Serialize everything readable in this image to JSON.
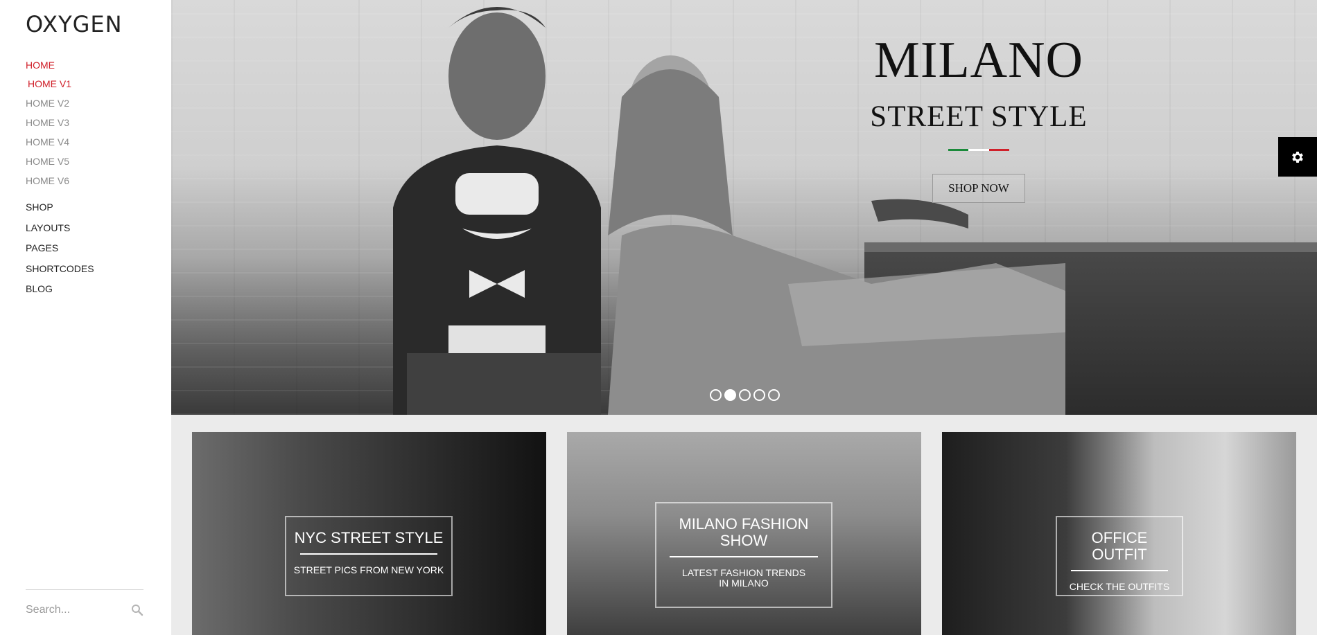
{
  "brand": {
    "logo": "OXYGEN"
  },
  "sidebar": {
    "home": {
      "label": "HOME",
      "sub": [
        {
          "label": "HOME V1"
        },
        {
          "label": "HOME V2"
        },
        {
          "label": "HOME V3"
        },
        {
          "label": "HOME V4"
        },
        {
          "label": "HOME V5"
        },
        {
          "label": "HOME V6"
        }
      ]
    },
    "items": [
      {
        "label": "SHOP"
      },
      {
        "label": "LAYOUTS"
      },
      {
        "label": "PAGES"
      },
      {
        "label": "SHORTCODES"
      },
      {
        "label": "BLOG"
      }
    ],
    "search": {
      "placeholder": "Search..."
    }
  },
  "hero": {
    "title": "MILANO",
    "subtitle": "STREET STYLE",
    "flag_colors": [
      "#1a8a3a",
      "#ffffff",
      "#d0202a"
    ],
    "cta": "SHOP NOW",
    "slides": 5,
    "active_slide": 2
  },
  "settings": {
    "icon": "gear-icon"
  },
  "cards": [
    {
      "title": "NYC STREET STYLE",
      "subtitle": "STREET PICS FROM NEW YORK"
    },
    {
      "title": "MILANO FASHION SHOW",
      "subtitle": "LATEST FASHION TRENDS IN MILANO"
    },
    {
      "title": "OFFICE OUTFIT",
      "subtitle": "CHECK THE OUTFITS"
    }
  ],
  "colors": {
    "accent": "#d0202a",
    "muted": "#8a8a8a"
  }
}
